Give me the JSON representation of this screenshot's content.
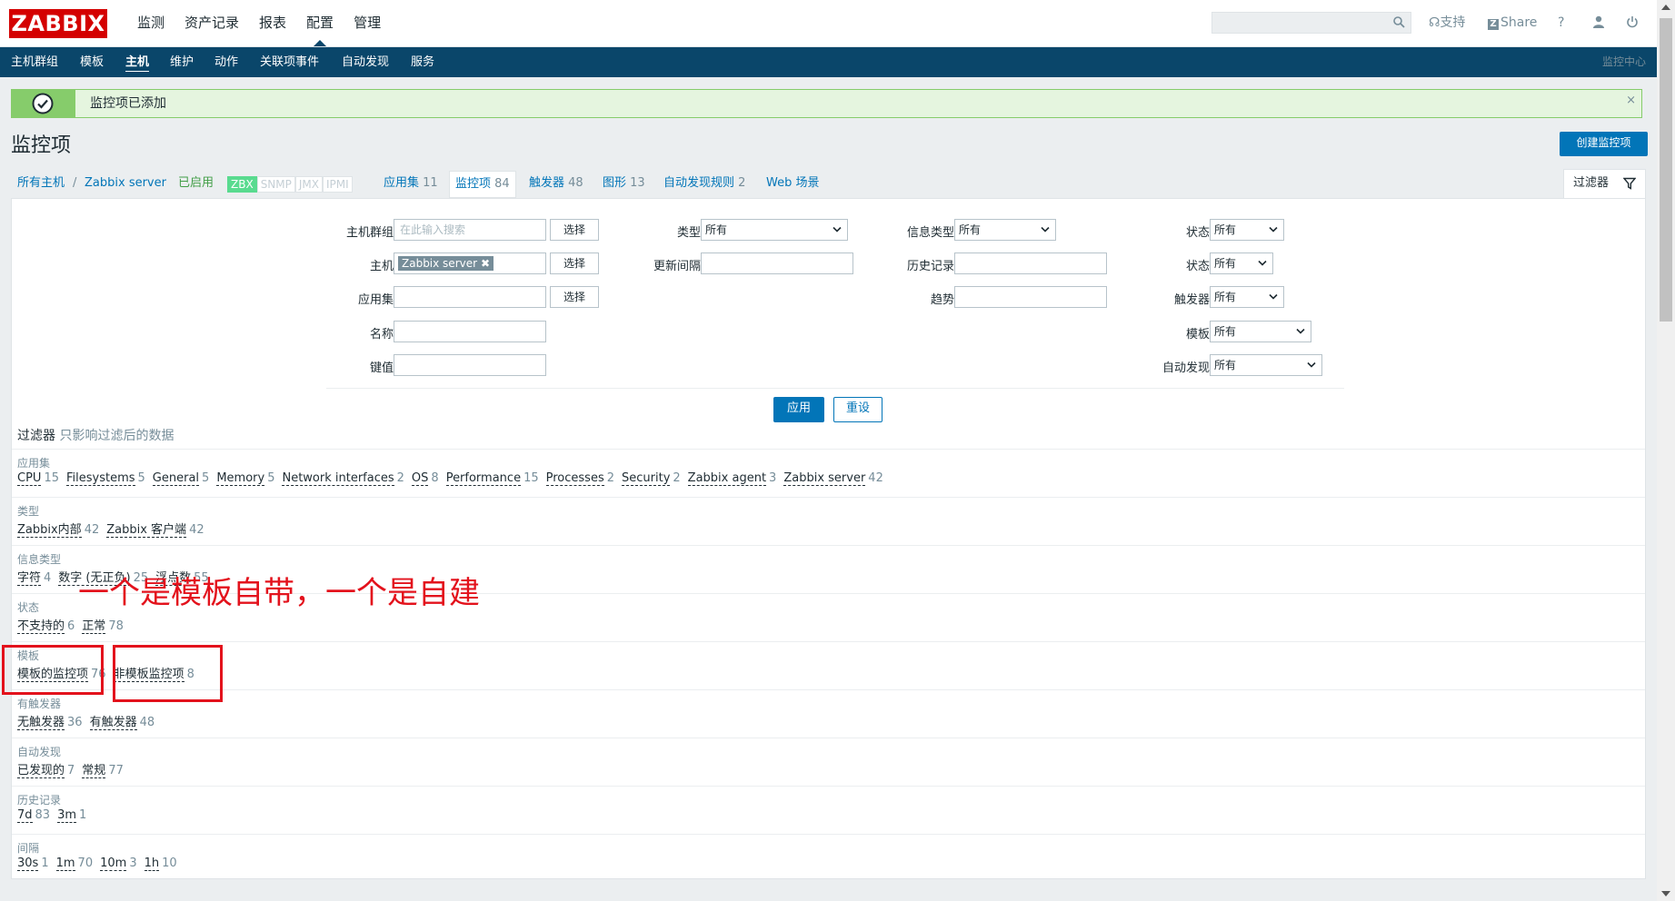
{
  "header": {
    "logo": "ZABBIX",
    "menu": [
      "监测",
      "资产记录",
      "报表",
      "配置",
      "管理"
    ],
    "active_menu": "配置",
    "support": "支持",
    "share": "Share",
    "help": "?"
  },
  "subnav": {
    "items": [
      "主机群组",
      "模板",
      "主机",
      "维护",
      "动作",
      "关联项事件",
      "自动发现",
      "服务"
    ],
    "active": "主机",
    "right": "监控中心"
  },
  "message": {
    "text": "监控项已添加",
    "close": "×"
  },
  "page_title": "监控项",
  "create_button": "创建监控项",
  "host_nav": {
    "all_hosts": "所有主机",
    "sep": "/",
    "host": "Zabbix server",
    "enabled": "已启用",
    "badges": [
      {
        "label": "ZBX",
        "on": true
      },
      {
        "label": "SNMP",
        "on": false
      },
      {
        "label": "JMX",
        "on": false
      },
      {
        "label": "IPMI",
        "on": false
      }
    ],
    "tabs": [
      {
        "label": "应用集",
        "count": "11"
      },
      {
        "label": "监控项",
        "count": "84"
      },
      {
        "label": "触发器",
        "count": "48"
      },
      {
        "label": "图形",
        "count": "13"
      },
      {
        "label": "自动发现规则",
        "count": "2"
      },
      {
        "label": "Web 场景",
        "count": ""
      }
    ]
  },
  "filter_tab": "过滤器",
  "filter": {
    "host_groups_label": "主机群组",
    "host_groups_placeholder": "在此输入搜索",
    "hosts_label": "主机",
    "host_chip": "Zabbix server",
    "application_label": "应用集",
    "name_label": "名称",
    "key_label": "键值",
    "select_btn": "选择",
    "type_label": "类型",
    "type_value": "所有",
    "update_interval_label": "更新间隔",
    "info_type_label": "信息类型",
    "info_type_value": "所有",
    "history_label": "历史记录",
    "trends_label": "趋势",
    "state_label": "状态",
    "state_value": "所有",
    "status_label": "状态",
    "status_value": "所有",
    "triggers_label": "触发器",
    "triggers_value": "所有",
    "template_label": "模板",
    "template_value": "所有",
    "discovery_label": "自动发现",
    "discovery_value": "所有",
    "apply": "应用",
    "reset": "重设"
  },
  "subfilter": {
    "title": "过滤器",
    "hint": "只影响过滤后的数据",
    "groups": [
      {
        "name": "应用集",
        "items": [
          {
            "label": "CPU",
            "count": "15"
          },
          {
            "label": "Filesystems",
            "count": "5"
          },
          {
            "label": "General",
            "count": "5"
          },
          {
            "label": "Memory",
            "count": "5"
          },
          {
            "label": "Network interfaces",
            "count": "2"
          },
          {
            "label": "OS",
            "count": "8"
          },
          {
            "label": "Performance",
            "count": "15"
          },
          {
            "label": "Processes",
            "count": "2"
          },
          {
            "label": "Security",
            "count": "2"
          },
          {
            "label": "Zabbix agent",
            "count": "3"
          },
          {
            "label": "Zabbix server",
            "count": "42"
          }
        ]
      },
      {
        "name": "类型",
        "items": [
          {
            "label": "Zabbix内部",
            "count": "42"
          },
          {
            "label": "Zabbix 客户端",
            "count": "42"
          }
        ]
      },
      {
        "name": "信息类型",
        "items": [
          {
            "label": "字符",
            "count": "4"
          },
          {
            "label": "数字 (无正负)",
            "count": "25"
          },
          {
            "label": "浮点数",
            "count": "55"
          }
        ]
      },
      {
        "name": "状态",
        "items": [
          {
            "label": "不支持的",
            "count": "6"
          },
          {
            "label": "正常",
            "count": "78"
          }
        ]
      },
      {
        "name": "模板",
        "items": [
          {
            "label": "模板的监控项",
            "count": "76"
          },
          {
            "label": "非模板监控项",
            "count": "8"
          }
        ]
      },
      {
        "name": "有触发器",
        "items": [
          {
            "label": "无触发器",
            "count": "36"
          },
          {
            "label": "有触发器",
            "count": "48"
          }
        ]
      },
      {
        "name": "自动发现",
        "items": [
          {
            "label": "已发现的",
            "count": "7"
          },
          {
            "label": "常规",
            "count": "77"
          }
        ]
      },
      {
        "name": "历史记录",
        "items": [
          {
            "label": "7d",
            "count": "83"
          },
          {
            "label": "3m",
            "count": "1"
          }
        ]
      },
      {
        "name": "间隔",
        "items": [
          {
            "label": "30s",
            "count": "1"
          },
          {
            "label": "1m",
            "count": "70"
          },
          {
            "label": "10m",
            "count": "3"
          },
          {
            "label": "1h",
            "count": "10"
          }
        ]
      }
    ]
  },
  "annotation": "一个是模板自带，一个是自建",
  "colors": {
    "brand_red": "#d40000",
    "nav_blue": "#0a466a",
    "link_blue": "#0275b8",
    "success_green": "#86cc6b",
    "annotation_red": "#e3121c"
  }
}
